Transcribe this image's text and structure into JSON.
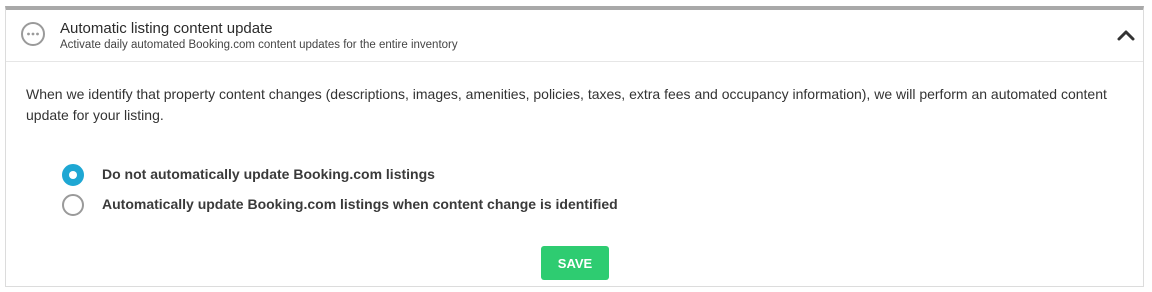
{
  "header": {
    "title": "Automatic listing content update",
    "subtitle": "Activate daily automated Booking.com content updates for the entire inventory",
    "status_icon": "ellipsis-circle-icon",
    "collapse_icon": "chevron-up-icon"
  },
  "description": "When we identify that property content changes (descriptions, images, amenities, policies, taxes, extra fees and occupancy information), we will perform an automated content update for your listing.",
  "options": [
    {
      "label": "Do not automatically update Booking.com listings",
      "selected": true
    },
    {
      "label": "Automatically update Booking.com listings when content change is identified",
      "selected": false
    }
  ],
  "save_label": "SAVE",
  "colors": {
    "radio_selected": "#1ea7d3",
    "save_button": "#2ecc71",
    "top_border": "#a9a9a9"
  }
}
